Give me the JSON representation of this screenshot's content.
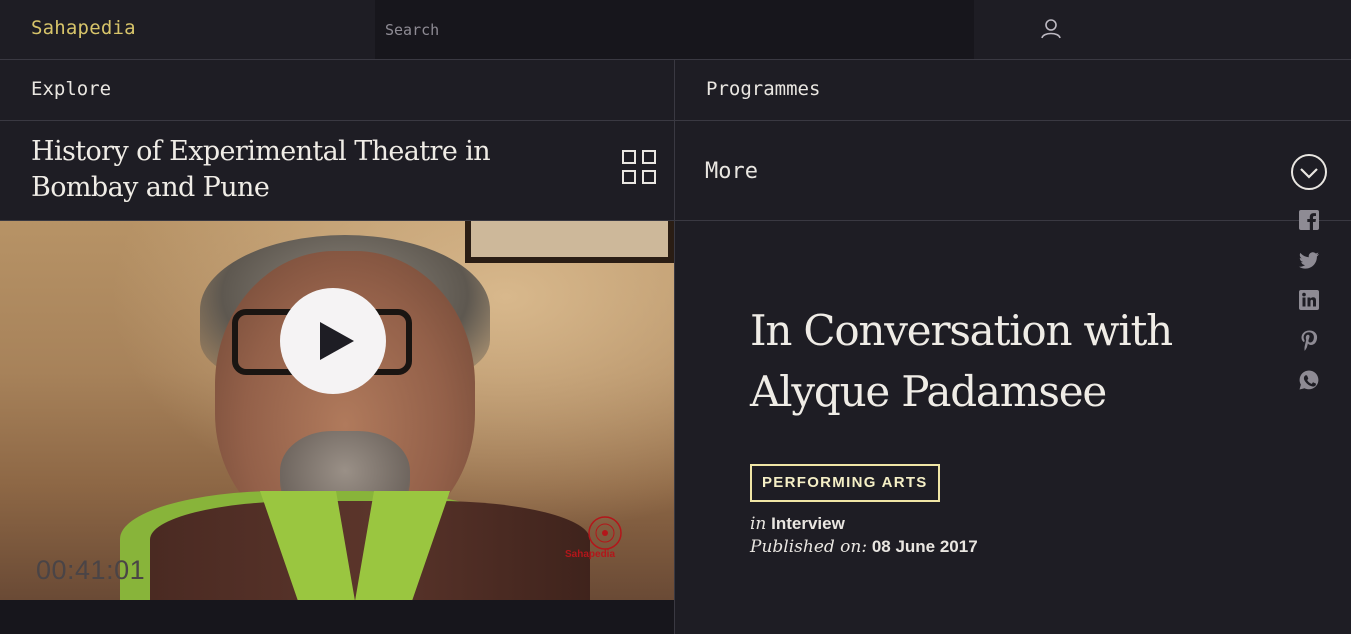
{
  "header": {
    "logo": "Sahapedia",
    "search_placeholder": "Search",
    "user_icon": "user-icon"
  },
  "nav": {
    "explore": "Explore",
    "programmes": "Programmes"
  },
  "series": {
    "title": "History of Experimental Theatre in Bombay and Pune",
    "more_label": "More"
  },
  "video": {
    "timecode": "00:41:01",
    "watermark": "Sahapedia"
  },
  "article": {
    "title": "In Conversation with Alyque Padamsee",
    "category": "PERFORMING ARTS",
    "in_label": "in",
    "type": "Interview",
    "published_label": "Published on:",
    "published_date": "08 June 2017"
  },
  "share": [
    "facebook-icon",
    "twitter-icon",
    "linkedin-icon",
    "pinterest-icon",
    "whatsapp-icon"
  ],
  "colors": {
    "background": "#1e1d24",
    "logo": "#d7c46a",
    "badge_border": "#f0e6a6"
  }
}
